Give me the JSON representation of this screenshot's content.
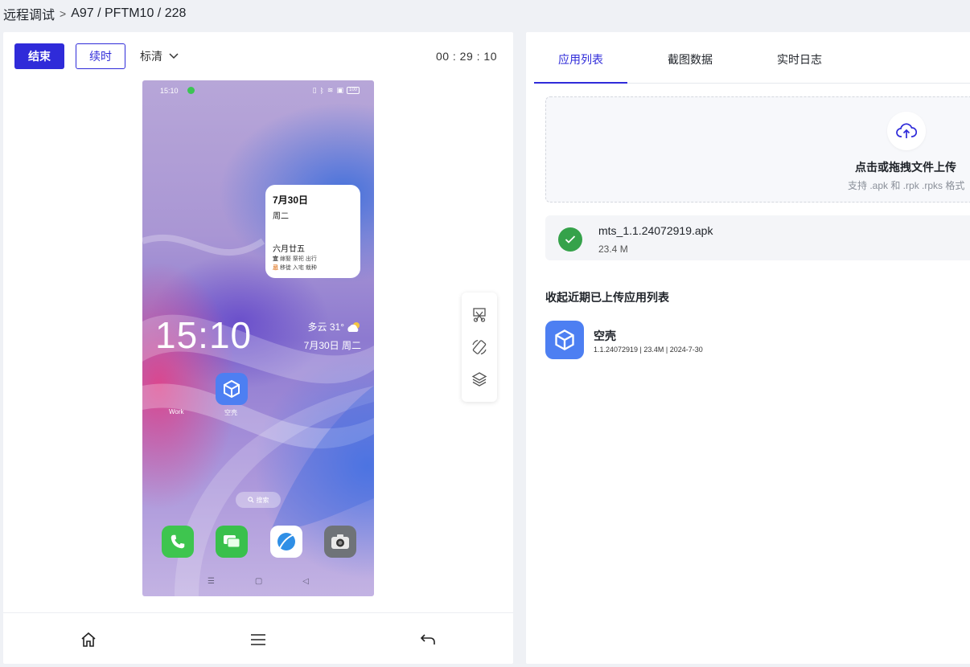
{
  "breadcrumb": {
    "root": "远程调试",
    "separator": ">",
    "device": "A97 / PFTM10 / 228"
  },
  "toolbar": {
    "end_label": "结束",
    "renew_label": "续时",
    "quality_label": "标清",
    "timer": "00 : 29 : 10"
  },
  "phone": {
    "status_time": "15:10",
    "battery": "100",
    "widget": {
      "date": "7月30日",
      "weekday": "周二",
      "lunar": "六月廿五",
      "yi_label": "宜",
      "yi_text": "嫁娶 祭祀 出行",
      "ji_label": "忌",
      "ji_text": "移徙 入宅 栽种"
    },
    "clock": "15:10",
    "weather": "多云 31°",
    "weather_date": "7月30日  周二",
    "app_work": "Work",
    "app_kongke": "空壳",
    "search": "搜索"
  },
  "tabs": [
    {
      "label": "应用列表"
    },
    {
      "label": "截图数据"
    },
    {
      "label": "实时日志"
    }
  ],
  "upload": {
    "title": "点击或拖拽文件上传",
    "hint": "支持 .apk 和 .rpk .rpks 格式"
  },
  "uploaded_file": {
    "name": "mts_1.1.24072919.apk",
    "size": "23.4 M"
  },
  "recent": {
    "title": "收起近期已上传应用列表",
    "apps": [
      {
        "name": "空壳",
        "meta": "1.1.24072919  |  23.4M  |  2024-7-30"
      }
    ]
  },
  "colors": {
    "primary": "#2f2bd9",
    "success": "#35a24a",
    "app_icon": "#4d7ff2"
  }
}
